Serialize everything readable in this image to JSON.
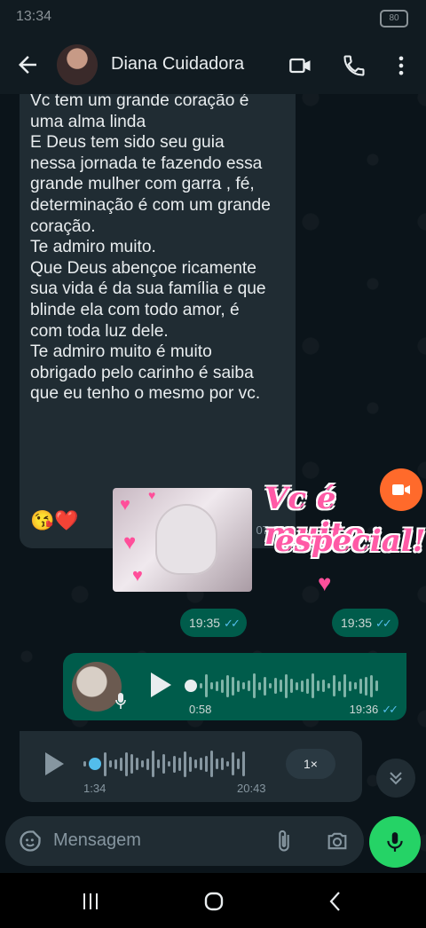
{
  "status": {
    "time": "13:34",
    "battery": "80"
  },
  "header": {
    "contact_name": "Diana Cuidadora"
  },
  "messages": {
    "incoming_text": "Vc tem um grande coração é\numa alma linda\nE Deus tem sido seu guia\nnessa jornada te fazendo essa\ngrande mulher com garra , fé,\ndeterminação é com um grande\ncoração.\nTe admiro muito.\nQue Deus abençoe ricamente\nsua vida é da sua família e que\nblinde ela com todo amor, é\ncom toda luz dele.\nTe admiro muito é muito\nobrigado pelo carinho é saiba\nque eu tenho o mesmo por vc.",
    "incoming_emoji": "😘❤️",
    "incoming_time": "07:25",
    "sticker2_line1": "Vc é muito",
    "sticker2_line2": "especial!",
    "sticker1_time": "19:35",
    "sticker2_time": "19:35",
    "outgoing_audio": {
      "duration": "0:58",
      "time": "19:36",
      "progress": 0
    },
    "incoming_audio": {
      "position": "1:34",
      "time": "20:43",
      "speed": "1×",
      "progress": 0.05
    }
  },
  "composer": {
    "placeholder": "Mensagem"
  },
  "colors": {
    "outgoing_bubble": "#005c4b",
    "incoming_bubble": "#202c33",
    "read_ticks": "#53bdeb",
    "accent_green": "#25d366",
    "video_fab": "#ff6a2b"
  },
  "icons": [
    "back-arrow-icon",
    "video-call-icon",
    "phone-icon",
    "more-options-icon",
    "play-icon",
    "mic-icon",
    "chevron-double-down-icon",
    "emoji-sticker-icon",
    "attach-icon",
    "camera-icon",
    "nav-recents-icon",
    "nav-home-icon",
    "nav-back-icon"
  ]
}
